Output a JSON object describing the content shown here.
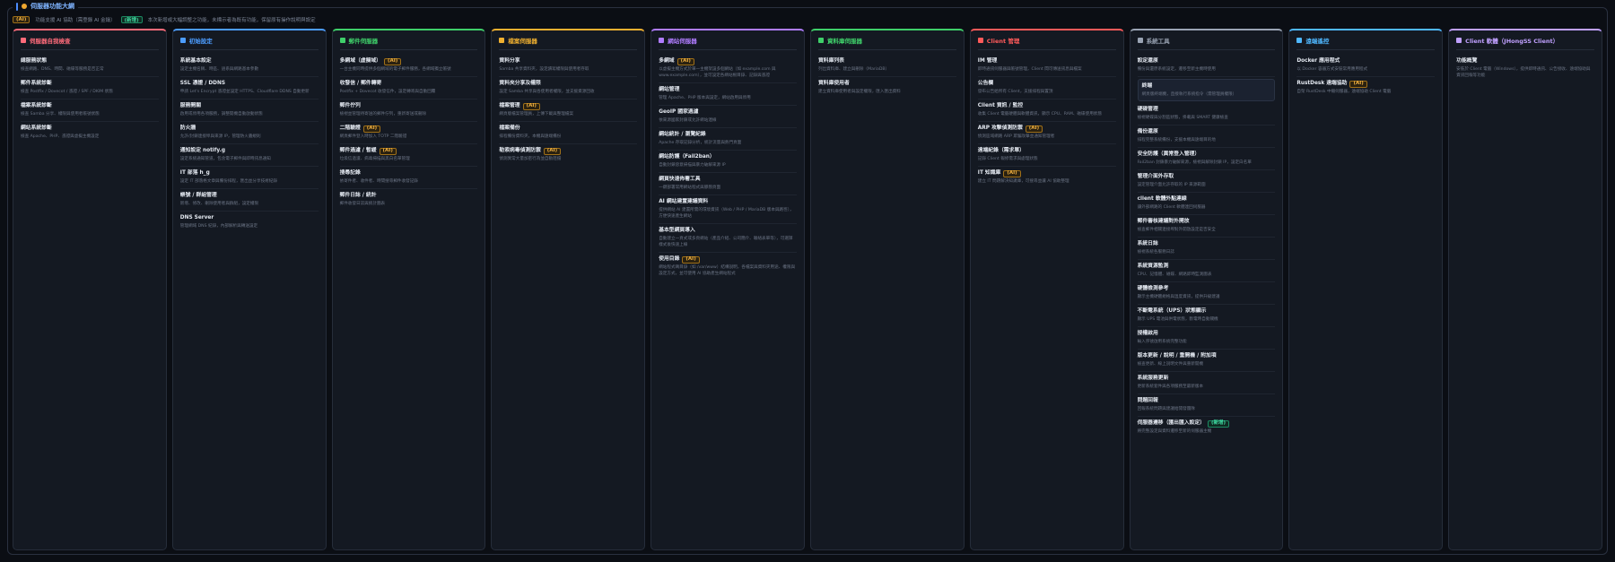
{
  "page": {
    "title": "伺服器功能大綱",
    "legend_ai_badge": "(AI)",
    "legend_ai_text": "功能支援 AI 協助（需登錄 AI 金鑰）",
    "legend_new_badge": "(新增)",
    "legend_new_text": "本次新增或大幅調整之功能，未標示者為既有功能，保留原有操作說明與設定"
  },
  "colors": {
    "ai": "#f0b040",
    "new": "#3fd8a0"
  },
  "columns": [
    {
      "title": "伺服器自我檢查",
      "accent": "#ff6b7a",
      "icon": "check-icon",
      "items": [
        {
          "title": "總服務狀態",
          "desc": "檢查網路、DNS、時間、磁碟等服務是否正常",
          "ai": false,
          "new": false
        },
        {
          "title": "郵件系統診斷",
          "desc": "檢查 Postfix / Dovecot / 憑證 / SPF / DKIM 狀態",
          "ai": false,
          "new": false
        },
        {
          "title": "檔案系統診斷",
          "desc": "檢查 Samba 分享、權限與使用者帳號狀態",
          "ai": false,
          "new": false
        },
        {
          "title": "網站系統診斷",
          "desc": "檢查 Apache、PHP、憑證與虛擬主機設定",
          "ai": false,
          "new": false
        }
      ]
    },
    {
      "title": "初始設定",
      "accent": "#4c9dff",
      "icon": "gear-icon",
      "items": [
        {
          "title": "系統基本設定",
          "desc": "設定主機名稱、時區、語系與網路基本參數",
          "ai": false,
          "new": false
        },
        {
          "title": "SSL 憑證 / DDNS",
          "desc": "申請 Let's Encrypt 憑證並設定 HTTPS、Cloudflare DDNS 自動更新",
          "ai": false,
          "new": false
        },
        {
          "title": "服務開關",
          "desc": "啟用或停用各項服務，調整開機自動啟動狀態",
          "ai": false,
          "new": false
        },
        {
          "title": "防火牆",
          "desc": "允許/封鎖連接埠與來源 IP，管理防火牆規則",
          "ai": false,
          "new": false
        },
        {
          "title": "通知設定 notify.g",
          "desc": "設定系統通知管道，包含電子郵件與即時訊息通知",
          "ai": false,
          "new": false
        },
        {
          "title": "IT 部落 h_g",
          "desc": "設定 IT 部落格文章與備份排程，匯出並分享技術紀錄",
          "ai": false,
          "new": false
        },
        {
          "title": "帳號 / 群組管理",
          "desc": "新增、修改、刪除使用者與群組，設定權限",
          "ai": false,
          "new": false
        },
        {
          "title": "DNS Server",
          "desc": "管理網域 DNS 紀錄，內部解析與轉送設定",
          "ai": false,
          "new": false
        }
      ]
    },
    {
      "title": "郵件伺服器",
      "accent": "#3fcf6a",
      "icon": "mail-icon",
      "items": [
        {
          "title": "多網域（虛擬域）",
          "desc": "一台主機同時提供多個網域的電子郵件服務，各網域獨立帳號",
          "ai": true,
          "new": false
        },
        {
          "title": "收發信 / 郵件轉寄",
          "desc": "Postfix + Dovecot 收發信件，設定轉寄與自動回覆",
          "ai": false,
          "new": false
        },
        {
          "title": "郵件佇列",
          "desc": "檢視並管理待寄送的郵件佇列，重新寄送或刪除",
          "ai": false,
          "new": false
        },
        {
          "title": "二階驗證",
          "desc": "網頁郵件登入時加入 TOTP 二階驗證",
          "ai": true,
          "new": false
        },
        {
          "title": "郵件過濾 / 暫緩",
          "desc": "垃圾信過濾、病毒掃描與黑白名單管理",
          "ai": true,
          "new": false
        },
        {
          "title": "搜尋記錄",
          "desc": "依寄件者、收件者、時間搜尋郵件收發記錄",
          "ai": false,
          "new": false
        },
        {
          "title": "郵件日誌 / 統計",
          "desc": "郵件收發日誌與統計圖表",
          "ai": false,
          "new": false
        }
      ]
    },
    {
      "title": "檔案伺服器",
      "accent": "#f0b030",
      "icon": "folder-icon",
      "items": [
        {
          "title": "資料分享",
          "desc": "Samba 共享資料夾，設定讀寫權限與使用者存取",
          "ai": false,
          "new": false
        },
        {
          "title": "資料夾分享及權限",
          "desc": "設定 Samba 共享與各使用者權限，並支援資源回收",
          "ai": false,
          "new": false
        },
        {
          "title": "檔案管理",
          "desc": "網頁版檔案管理員，上傳下載與整理檔案",
          "ai": true,
          "new": false
        },
        {
          "title": "檔案備份",
          "desc": "排程備份資料夾，本機與遠端備份",
          "ai": false,
          "new": false
        },
        {
          "title": "勒索病毒偵測防禦",
          "desc": "偵測異常大量加密行為並自動阻擋",
          "ai": true,
          "new": false
        }
      ]
    },
    {
      "title": "網站伺服器",
      "accent": "#b07cff",
      "icon": "globe-icon",
      "items": [
        {
          "title": "多網域",
          "desc": "以虛擬主機方式於單一主機架設多個網站（如 example.com 與 www.example.com），並可設定各網站根目錄、記錄與憑證",
          "ai": true,
          "new": false
        },
        {
          "title": "網站管理",
          "desc": "管理 Apache、PHP 版本與設定，網站啟用與停用",
          "ai": false,
          "new": false
        },
        {
          "title": "GeoIP 國家過濾",
          "desc": "依來源國家封鎖或允許網站連線",
          "ai": false,
          "new": false
        },
        {
          "title": "網站統計 / 瀏覽紀錄",
          "desc": "Apache 存取記錄分析，統計流量與熱門頁面",
          "ai": false,
          "new": false
        },
        {
          "title": "網站防護（Fail2ban）",
          "desc": "自動封鎖惡意掃描與暴力破解來源 IP",
          "ai": false,
          "new": false
        },
        {
          "title": "網頁快速佈署工具",
          "desc": "一鍵部署常用網站程式與靜態頁面",
          "ai": false,
          "new": false
        },
        {
          "title": "AI 網站建置建議資料",
          "desc": "提供網站 AI 建置所需的環境資訊（Web / PHP / MariaDB 版本與路徑），方便快速產生網站",
          "ai": false,
          "new": false
        },
        {
          "title": "基本型網頁導入",
          "desc": "自動建立一頁式或多頁網站（產品介紹、公司簡介、聯絡表單等），可選擇樣式後快速上線",
          "ai": false,
          "new": false
        },
        {
          "title": "使用目錄",
          "desc": "網站程式碼目錄（如 /var/www）結構說明，各檔案與資料夾用途、權限與設定方式，並可使用 AI 協助產生網站程式",
          "ai": true,
          "new": false
        }
      ]
    },
    {
      "title": "資料庫伺服器",
      "accent": "#3fcf6a",
      "icon": "database-icon",
      "items": [
        {
          "title": "資料庫列表",
          "desc": "列出資料庫、建立與刪除（MariaDB）",
          "ai": false,
          "new": false
        },
        {
          "title": "資料庫使用者",
          "desc": "建立資料庫使用者與設定權限，匯入匯出資料",
          "ai": false,
          "new": false
        }
      ]
    },
    {
      "title": "Client 管理",
      "accent": "#ff5a5a",
      "icon": "monitor-icon",
      "items": [
        {
          "title": "IM 管理",
          "desc": "即時通訊伺服器與帳號管理，Client 間可傳送訊息與檔案",
          "ai": false,
          "new": false
        },
        {
          "title": "公告欄",
          "desc": "發布公告給所有 Client，支援排程與置頂",
          "ai": false,
          "new": false
        },
        {
          "title": "Client 資訊 / 監控",
          "desc": "收集 Client 電腦硬體與軟體資訊，顯示 CPU、RAM、磁碟使用狀態",
          "ai": false,
          "new": false
        },
        {
          "title": "ARP 攻擊偵測防禦",
          "desc": "偵測區域網路 ARP 欺騙攻擊並通知管理者",
          "ai": true,
          "new": false
        },
        {
          "title": "遠端紀錄（需求單）",
          "desc": "記錄 Client 報修需求與處理狀態",
          "ai": false,
          "new": false
        },
        {
          "title": "IT 知識庫",
          "desc": "建立 IT 問題解決知識庫，可搜尋並讓 AI 協助整理",
          "ai": true,
          "new": false
        }
      ]
    },
    {
      "title": "系統工具",
      "accent": "#9aa4b4",
      "icon": "wrench-icon",
      "items": [
        {
          "title": "設定還原",
          "desc": "備份與還原系統設定，遷移至新主機時使用",
          "ai": false,
          "new": false,
          "hl": false
        },
        {
          "title": "終端",
          "desc": "網頁版終端機，直接執行系統指令（需管理員權限）",
          "ai": false,
          "new": false,
          "hl": true
        },
        {
          "title": "硬碟管理",
          "desc": "檢視硬碟與分割區狀態，掛載與 SMART 健康檢查",
          "ai": false,
          "new": false,
          "hl": false
        },
        {
          "title": "備份還原",
          "desc": "排程完整系統備份，支援本機與遠端目的地",
          "ai": false,
          "new": false,
          "hl": false
        },
        {
          "title": "安全防護（異常登入管理）",
          "desc": "Fail2ban 封鎖暴力破解來源，檢視與解除封鎖 IP，設定白名單",
          "ai": false,
          "new": false,
          "hl": false
        },
        {
          "title": "管理介面外存取",
          "desc": "設定管理介面允許存取的 IP 來源範圍",
          "ai": false,
          "new": false,
          "hl": false
        },
        {
          "title": "client 軟體外點連線",
          "desc": "讓外部網路的 Client 軟體連回伺服器",
          "ai": false,
          "new": false,
          "hl": false
        },
        {
          "title": "郵件審核建議對外開放",
          "desc": "檢查郵件相關連接埠對外開放設定是否安全",
          "ai": false,
          "new": false,
          "hl": false
        },
        {
          "title": "系統日誌",
          "desc": "檢視系統各服務日誌",
          "ai": false,
          "new": false,
          "hl": false
        },
        {
          "title": "系統資源監測",
          "desc": "CPU、記憶體、磁碟、網路即時監測圖表",
          "ai": false,
          "new": false,
          "hl": false
        },
        {
          "title": "硬體檢測參考",
          "desc": "顯示主機硬體規格與溫度資訊，提供升級建議",
          "ai": false,
          "new": false,
          "hl": false
        },
        {
          "title": "不斷電系統（UPS）狀態顯示",
          "desc": "顯示 UPS 電池與供電狀態，斷電時自動關機",
          "ai": false,
          "new": false,
          "hl": false
        },
        {
          "title": "授權啟用",
          "desc": "輸入序號啟用系統完整功能",
          "ai": false,
          "new": false,
          "hl": false
        },
        {
          "title": "版本更新 / 說明 / 重開機 / 附加項",
          "desc": "檢查更新、線上說明文件與重新開機",
          "ai": false,
          "new": false,
          "hl": false
        },
        {
          "title": "系統服務更新",
          "desc": "更新系統套件與各項服務至最新版本",
          "ai": false,
          "new": false,
          "hl": false
        },
        {
          "title": "問題回報",
          "desc": "回報系統問題與建議給開發團隊",
          "ai": false,
          "new": false,
          "hl": false
        },
        {
          "title": "伺服器遷移（匯出匯入設定）",
          "desc": "將完整設定與資料遷移至新的伺服器主機",
          "ai": false,
          "new": true,
          "hl": false
        }
      ]
    },
    {
      "title": "遠端遙控",
      "accent": "#4fb8ff",
      "icon": "remote-icon",
      "items": [
        {
          "title": "Docker 應用程式",
          "desc": "以 Docker 容器方式安裝常用應用程式",
          "ai": false,
          "new": false
        },
        {
          "title": "RustDesk 遠端協助",
          "desc": "自架 RustDesk 中繼伺服器，遠端協助 Client 電腦",
          "ai": true,
          "new": false
        }
      ]
    },
    {
      "title": "Client 軟體（JHongSS Client）",
      "accent": "#c0a0ff",
      "icon": "laptop-icon",
      "items": [
        {
          "title": "功能概覽",
          "desc": "安裝於 Client 電腦（Windows），提供即時通訊、公告接收、遠端協助與資訊回報等功能",
          "ai": false,
          "new": false
        }
      ]
    }
  ]
}
